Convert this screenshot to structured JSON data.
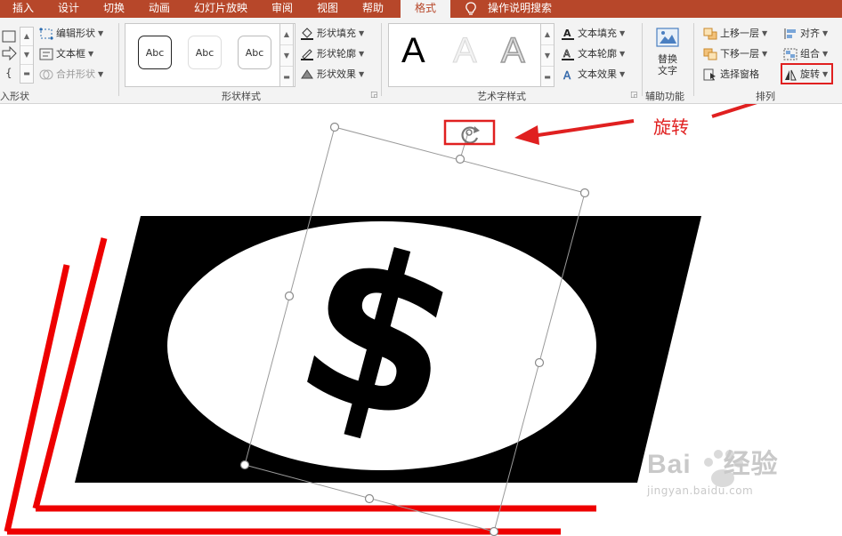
{
  "tabs": [
    {
      "label": "插入",
      "name": "tab-insert",
      "active": false
    },
    {
      "label": "设计",
      "name": "tab-design",
      "active": false
    },
    {
      "label": "切换",
      "name": "tab-transitions",
      "active": false
    },
    {
      "label": "动画",
      "name": "tab-animations",
      "active": false
    },
    {
      "label": "幻灯片放映",
      "name": "tab-slideshow",
      "active": false
    },
    {
      "label": "审阅",
      "name": "tab-review",
      "active": false
    },
    {
      "label": "视图",
      "name": "tab-view",
      "active": false
    },
    {
      "label": "帮助",
      "name": "tab-help",
      "active": false
    },
    {
      "label": "格式",
      "name": "tab-format",
      "active": true
    }
  ],
  "search": {
    "label": "操作说明搜索",
    "icon": "lightbulb-icon"
  },
  "groups": {
    "insert_shapes": {
      "label": "入形状",
      "edit_shape": "编辑形状",
      "text_box": "文本框",
      "merge_shapes": "合并形状"
    },
    "shape_styles": {
      "label": "形状样式",
      "samples": [
        "Abc",
        "Abc",
        "Abc"
      ],
      "fill": "形状填充",
      "outline": "形状轮廓",
      "effects": "形状效果"
    },
    "wordart_styles": {
      "label": "艺术字样式",
      "samples": [
        "A",
        "A",
        "A"
      ],
      "text_fill": "文本填充",
      "text_outline": "文本轮廓",
      "text_effects": "文本效果"
    },
    "accessibility": {
      "label": "辅助功能",
      "alt_text_line1": "替换",
      "alt_text_line2": "文字"
    },
    "arrange": {
      "label": "排列",
      "bring_forward": "上移一层",
      "send_backward": "下移一层",
      "selection_pane": "选择窗格",
      "align": "对齐",
      "group": "组合",
      "rotate": "旋转"
    }
  },
  "slide": {
    "dollar_symbol": "$",
    "annotation": "旋转"
  },
  "watermark": {
    "brand_prefix": "Bai",
    "brand_suffix": "经验",
    "url": "jingyan.baidu.com"
  },
  "colors": {
    "brand": "#b7472a",
    "highlight": "#e02020"
  }
}
